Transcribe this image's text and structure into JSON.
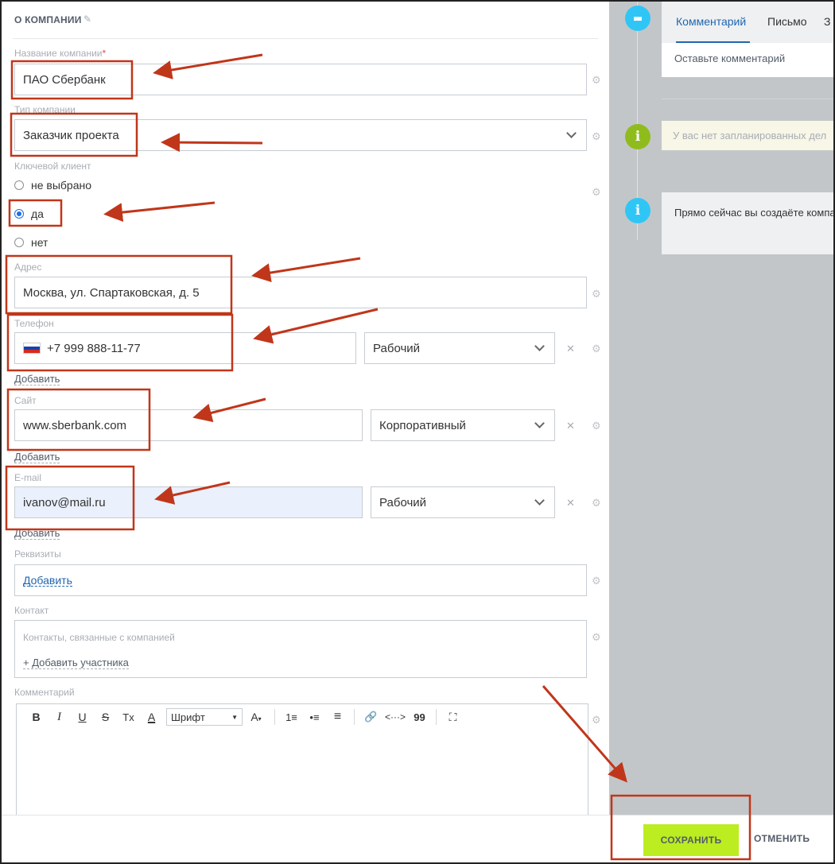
{
  "section": {
    "title": "О КОМПАНИИ"
  },
  "company_name": {
    "label": "Название компании",
    "required_mark": "*",
    "value": "ПАО Сбербанк"
  },
  "company_type": {
    "label": "Тип компании",
    "value": "Заказчик проекта"
  },
  "key_client": {
    "label": "Ключевой клиент",
    "options": [
      "не выбрано",
      "да",
      "нет"
    ],
    "selected": "да"
  },
  "address": {
    "label": "Адрес",
    "value": "Москва, ул. Спартаковская, д. 5"
  },
  "phone": {
    "label": "Телефон",
    "value": "+7 999 888-11-77",
    "type": "Рабочий",
    "add": "Добавить"
  },
  "site": {
    "label": "Сайт",
    "value": "www.sberbank.com",
    "type": "Корпоративный",
    "add": "Добавить"
  },
  "email": {
    "label": "E-mail",
    "value": "ivanov@mail.ru",
    "type": "Рабочий",
    "add": "Добавить"
  },
  "requisites": {
    "label": "Реквизиты",
    "add": "Добавить"
  },
  "contact": {
    "label": "Контакт",
    "placeholder": "Контакты, связанные с компанией",
    "add_participant": "+ Добавить участника"
  },
  "comment": {
    "label": "Комментарий",
    "toolbar": {
      "bold": "B",
      "italic": "I",
      "underline": "U",
      "strike": "S",
      "clear": "Tx",
      "color": "A",
      "font": "Шрифт",
      "size": "A",
      "list_ol": "1≡",
      "list_ul": "•≡",
      "align": "≡",
      "link": "🔗",
      "code": "<···>",
      "quote": "99",
      "fullscreen": "⛶"
    }
  },
  "timeline": {
    "tabs": [
      "Комментарий",
      "Письмо",
      "З"
    ],
    "comment_placeholder": "Оставьте комментарий",
    "planned": "У вас нет запланированных дел",
    "info": "Прямо сейчас вы создаёте компанию"
  },
  "footer": {
    "save": "СОХРАНИТЬ",
    "cancel": "ОТМЕНИТЬ"
  },
  "colors": {
    "annotation": "#c0361a",
    "save_bg": "#bbed21",
    "accent_blue": "#2067b0",
    "chat_icon": "#2fc6f6",
    "info_green": "#8fbc1c",
    "info_blue": "#2fc6f6"
  }
}
